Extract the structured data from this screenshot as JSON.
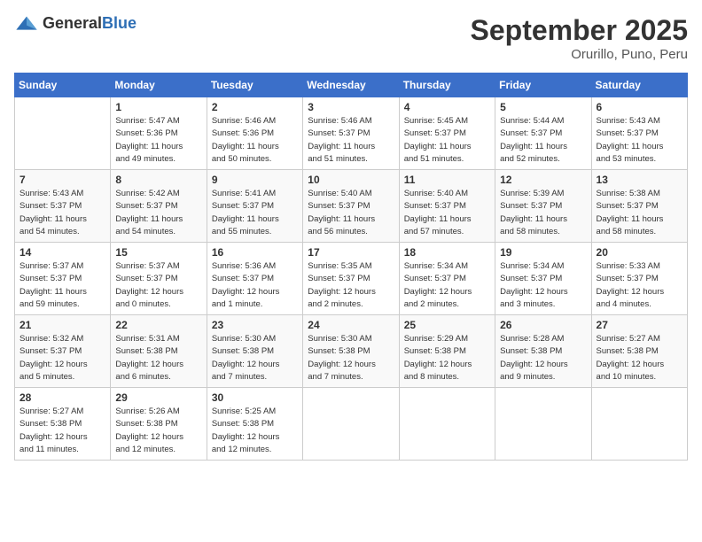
{
  "header": {
    "logo_general": "General",
    "logo_blue": "Blue",
    "month": "September 2025",
    "location": "Orurillo, Puno, Peru"
  },
  "weekdays": [
    "Sunday",
    "Monday",
    "Tuesday",
    "Wednesday",
    "Thursday",
    "Friday",
    "Saturday"
  ],
  "weeks": [
    [
      {
        "day": "",
        "info": ""
      },
      {
        "day": "1",
        "info": "Sunrise: 5:47 AM\nSunset: 5:36 PM\nDaylight: 11 hours\nand 49 minutes."
      },
      {
        "day": "2",
        "info": "Sunrise: 5:46 AM\nSunset: 5:36 PM\nDaylight: 11 hours\nand 50 minutes."
      },
      {
        "day": "3",
        "info": "Sunrise: 5:46 AM\nSunset: 5:37 PM\nDaylight: 11 hours\nand 51 minutes."
      },
      {
        "day": "4",
        "info": "Sunrise: 5:45 AM\nSunset: 5:37 PM\nDaylight: 11 hours\nand 51 minutes."
      },
      {
        "day": "5",
        "info": "Sunrise: 5:44 AM\nSunset: 5:37 PM\nDaylight: 11 hours\nand 52 minutes."
      },
      {
        "day": "6",
        "info": "Sunrise: 5:43 AM\nSunset: 5:37 PM\nDaylight: 11 hours\nand 53 minutes."
      }
    ],
    [
      {
        "day": "7",
        "info": "Sunrise: 5:43 AM\nSunset: 5:37 PM\nDaylight: 11 hours\nand 54 minutes."
      },
      {
        "day": "8",
        "info": "Sunrise: 5:42 AM\nSunset: 5:37 PM\nDaylight: 11 hours\nand 54 minutes."
      },
      {
        "day": "9",
        "info": "Sunrise: 5:41 AM\nSunset: 5:37 PM\nDaylight: 11 hours\nand 55 minutes."
      },
      {
        "day": "10",
        "info": "Sunrise: 5:40 AM\nSunset: 5:37 PM\nDaylight: 11 hours\nand 56 minutes."
      },
      {
        "day": "11",
        "info": "Sunrise: 5:40 AM\nSunset: 5:37 PM\nDaylight: 11 hours\nand 57 minutes."
      },
      {
        "day": "12",
        "info": "Sunrise: 5:39 AM\nSunset: 5:37 PM\nDaylight: 11 hours\nand 58 minutes."
      },
      {
        "day": "13",
        "info": "Sunrise: 5:38 AM\nSunset: 5:37 PM\nDaylight: 11 hours\nand 58 minutes."
      }
    ],
    [
      {
        "day": "14",
        "info": "Sunrise: 5:37 AM\nSunset: 5:37 PM\nDaylight: 11 hours\nand 59 minutes."
      },
      {
        "day": "15",
        "info": "Sunrise: 5:37 AM\nSunset: 5:37 PM\nDaylight: 12 hours\nand 0 minutes."
      },
      {
        "day": "16",
        "info": "Sunrise: 5:36 AM\nSunset: 5:37 PM\nDaylight: 12 hours\nand 1 minute."
      },
      {
        "day": "17",
        "info": "Sunrise: 5:35 AM\nSunset: 5:37 PM\nDaylight: 12 hours\nand 2 minutes."
      },
      {
        "day": "18",
        "info": "Sunrise: 5:34 AM\nSunset: 5:37 PM\nDaylight: 12 hours\nand 2 minutes."
      },
      {
        "day": "19",
        "info": "Sunrise: 5:34 AM\nSunset: 5:37 PM\nDaylight: 12 hours\nand 3 minutes."
      },
      {
        "day": "20",
        "info": "Sunrise: 5:33 AM\nSunset: 5:37 PM\nDaylight: 12 hours\nand 4 minutes."
      }
    ],
    [
      {
        "day": "21",
        "info": "Sunrise: 5:32 AM\nSunset: 5:37 PM\nDaylight: 12 hours\nand 5 minutes."
      },
      {
        "day": "22",
        "info": "Sunrise: 5:31 AM\nSunset: 5:38 PM\nDaylight: 12 hours\nand 6 minutes."
      },
      {
        "day": "23",
        "info": "Sunrise: 5:30 AM\nSunset: 5:38 PM\nDaylight: 12 hours\nand 7 minutes."
      },
      {
        "day": "24",
        "info": "Sunrise: 5:30 AM\nSunset: 5:38 PM\nDaylight: 12 hours\nand 7 minutes."
      },
      {
        "day": "25",
        "info": "Sunrise: 5:29 AM\nSunset: 5:38 PM\nDaylight: 12 hours\nand 8 minutes."
      },
      {
        "day": "26",
        "info": "Sunrise: 5:28 AM\nSunset: 5:38 PM\nDaylight: 12 hours\nand 9 minutes."
      },
      {
        "day": "27",
        "info": "Sunrise: 5:27 AM\nSunset: 5:38 PM\nDaylight: 12 hours\nand 10 minutes."
      }
    ],
    [
      {
        "day": "28",
        "info": "Sunrise: 5:27 AM\nSunset: 5:38 PM\nDaylight: 12 hours\nand 11 minutes."
      },
      {
        "day": "29",
        "info": "Sunrise: 5:26 AM\nSunset: 5:38 PM\nDaylight: 12 hours\nand 12 minutes."
      },
      {
        "day": "30",
        "info": "Sunrise: 5:25 AM\nSunset: 5:38 PM\nDaylight: 12 hours\nand 12 minutes."
      },
      {
        "day": "",
        "info": ""
      },
      {
        "day": "",
        "info": ""
      },
      {
        "day": "",
        "info": ""
      },
      {
        "day": "",
        "info": ""
      }
    ]
  ]
}
